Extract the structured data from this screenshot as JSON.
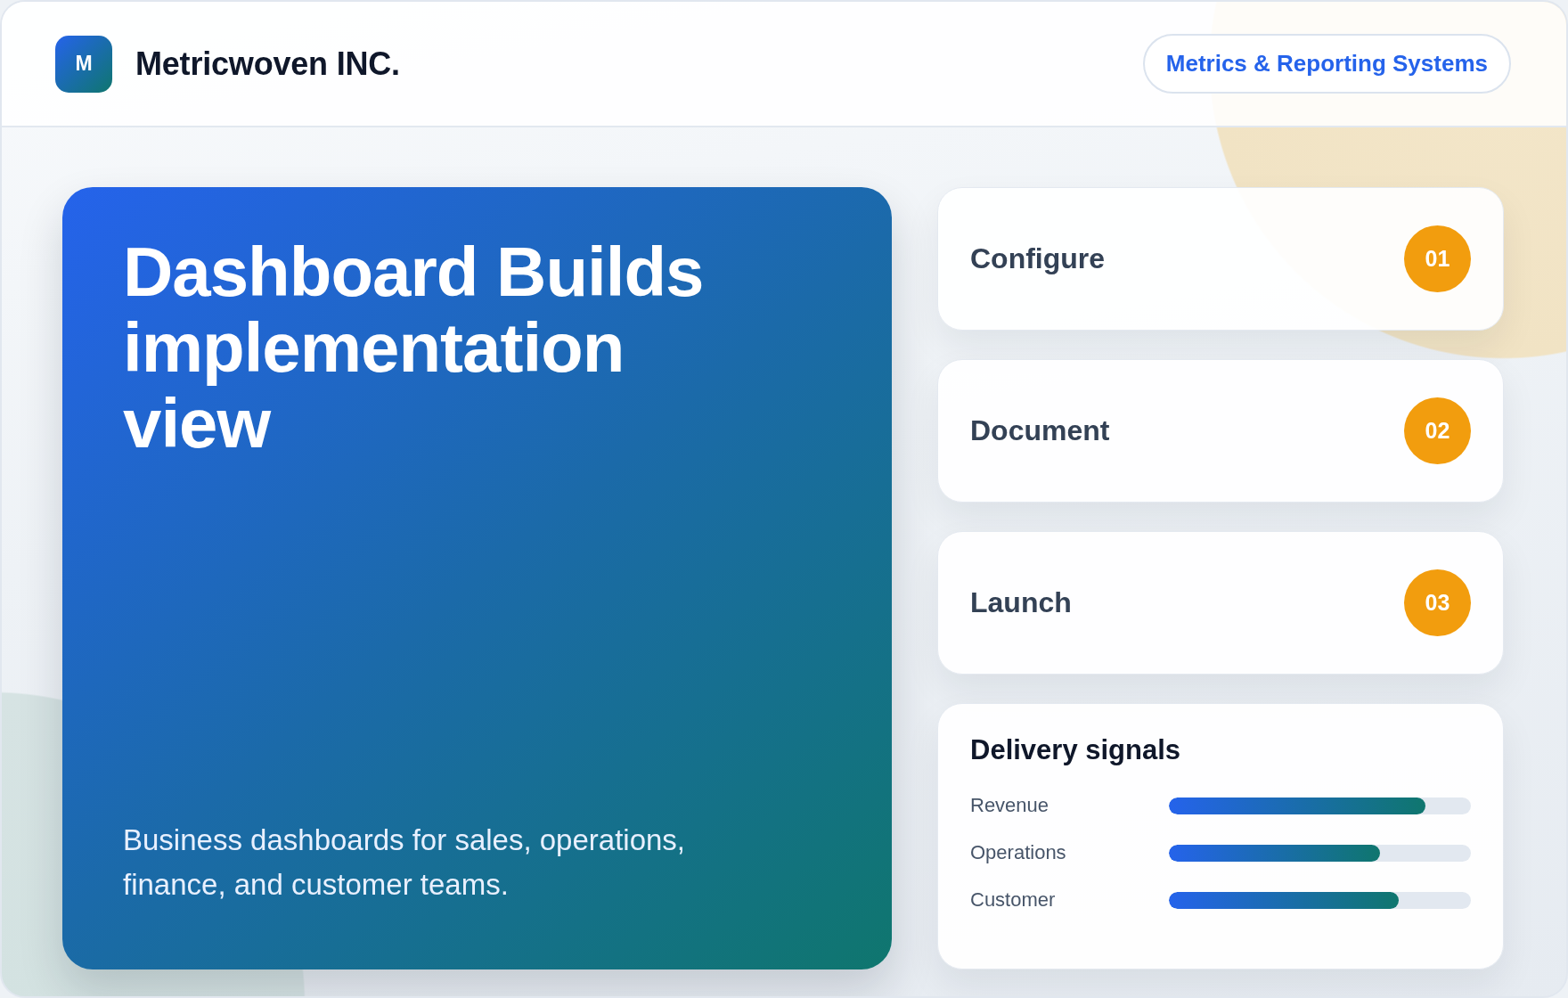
{
  "header": {
    "logo_letter": "M",
    "company": "Metricwoven INC.",
    "tag": "Metrics & Reporting Systems"
  },
  "hero": {
    "title": "Dashboard Builds implementation view",
    "subtitle": "Business dashboards for sales, operations, finance, and customer teams."
  },
  "steps": [
    {
      "label": "Configure",
      "number": "01"
    },
    {
      "label": "Document",
      "number": "02"
    },
    {
      "label": "Launch",
      "number": "03"
    }
  ],
  "signals": {
    "title": "Delivery signals",
    "items": [
      {
        "label": "Revenue",
        "level": 0.85
      },
      {
        "label": "Operations",
        "level": 0.7
      },
      {
        "label": "Customer",
        "level": 0.76
      }
    ]
  }
}
